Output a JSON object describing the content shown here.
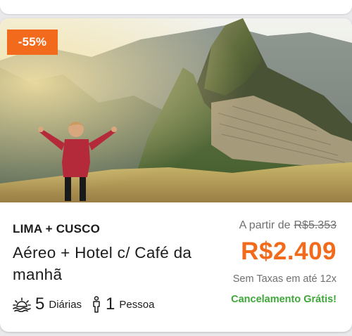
{
  "card": {
    "discount_badge": "-55%",
    "destination": "LIMA + CUSCO",
    "package_title": "Aéreo + Hotel c/ Café da manhã",
    "nights_count": "5",
    "nights_label": "Diárias",
    "people_count": "1",
    "people_label": "Pessoa",
    "from_label": "A partir de",
    "old_price": "R$5.353",
    "price": "R$2.409",
    "taxes_note": "Sem Taxas em até 12x",
    "cancellation": "Cancelamento Grátis!",
    "icons": [
      "sunset-icon",
      "person-icon"
    ],
    "colors": {
      "accent": "#f26a1b",
      "success": "#3fa63a",
      "muted": "#6f6f6f"
    }
  }
}
